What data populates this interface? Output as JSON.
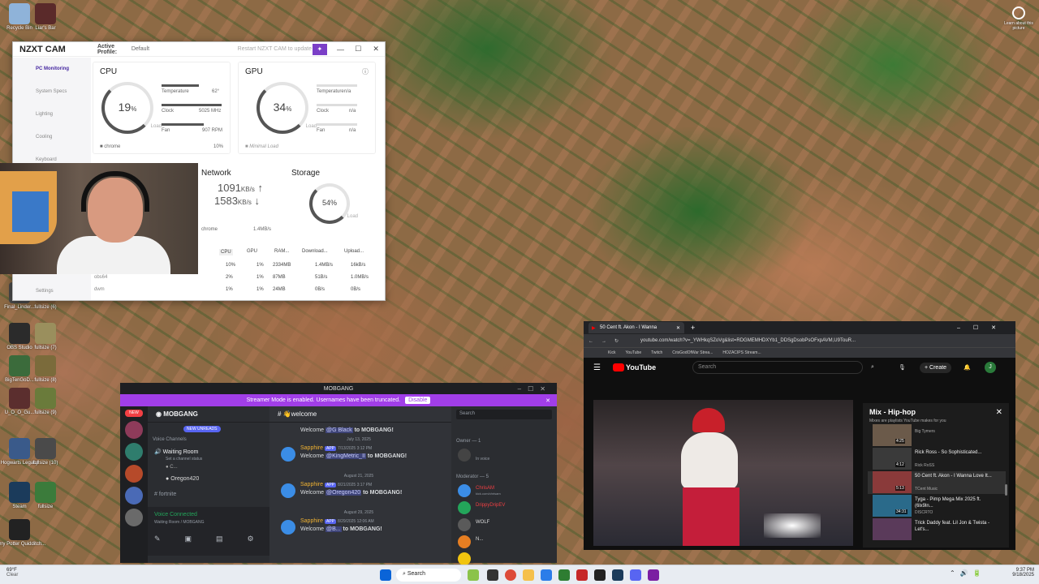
{
  "desktop": {
    "icons_left": [
      {
        "label": "Recycle Bin",
        "color": "#8fb3d9"
      },
      {
        "label": "Liar's Bar",
        "color": "#5a2a2a"
      },
      {
        "label": "OBS Studio",
        "color": "#2b2b2b"
      },
      {
        "label": "fullsize (7)",
        "color": "#9a8f5d"
      },
      {
        "label": "BigTenGoD...",
        "color": "#3b6b3b"
      },
      {
        "label": "fullsize (8)",
        "color": "#7b6b3b"
      },
      {
        "label": "U_O_O_Gu...",
        "color": "#5b2e2e"
      },
      {
        "label": "fullsize (9)",
        "color": "#6a7b3b"
      },
      {
        "label": "Hogwarts Legacy",
        "color": "#3a5a8a"
      },
      {
        "label": "fullsize (10)",
        "color": "#4a4a4a"
      },
      {
        "label": "Steam",
        "color": "#1b3b5b"
      },
      {
        "label": "fullsize",
        "color": "#3b7b3b"
      },
      {
        "label": "Harry Potter Quidditch...",
        "color": "#222222"
      },
      {
        "label": "Final_Linder...",
        "color": "#4a4a4a"
      },
      {
        "label": "fullsize (6)",
        "color": "#7b5a3b"
      }
    ],
    "learn_more": "Learn about this picture"
  },
  "nzxt": {
    "app_name": "NZXT CAM",
    "active_profile_label": "Active Profile:",
    "active_profile_value": "Default",
    "restart_label": "Restart NZXT CAM to update",
    "sidebar": [
      "PC Monitoring",
      "System Specs",
      "Lighting",
      "Cooling",
      "Keyboard"
    ],
    "settings": "Settings",
    "cpu": {
      "title": "CPU",
      "load": "19",
      "load_unit": "%",
      "load_label": "Load",
      "temp_label": "Temperature",
      "temp": "62°",
      "clock_label": "Clock",
      "clock": "5025 MHz",
      "fan_label": "Fan",
      "fan": "907 RPM",
      "top_proc": "chrome",
      "top_proc_pct": "10%"
    },
    "gpu": {
      "title": "GPU",
      "load": "34",
      "load_unit": "%",
      "load_label": "Load",
      "temp_label": "Temperature",
      "temp": "n/a",
      "clock_label": "Clock",
      "clock": "n/a",
      "fan_label": "Fan",
      "fan": "n/a",
      "note": "Minimal Load"
    },
    "network": {
      "title": "Network",
      "down": "1091",
      "down_unit": "KB/s",
      "up": "1583",
      "up_unit": "KB/s",
      "top_proc": "chrome",
      "top_proc_val": "1.4MB/s"
    },
    "storage": {
      "title": "Storage",
      "pct": "54%",
      "load_label": "Load"
    },
    "table_headers": [
      "CPU",
      "GPU",
      "RAM...",
      "Download...",
      "Upload..."
    ],
    "rows": [
      {
        "name": "chrome",
        "cpu": "10%",
        "gpu": "1%",
        "ram": "2334MB",
        "down": "1.4MB/s",
        "up": "16kB/s"
      },
      {
        "name": "obs64",
        "cpu": "2%",
        "gpu": "1%",
        "ram": "87MB",
        "down": "51B/s",
        "up": "1.0MB/s"
      },
      {
        "name": "dwm",
        "cpu": "1%",
        "gpu": "1%",
        "ram": "24MB",
        "down": "0B/s",
        "up": "0B/s"
      }
    ]
  },
  "discord": {
    "title": "MOBGANG",
    "streamer_banner": "Streamer Mode is enabled. Usernames have been truncated.",
    "disable_label": "Disable",
    "server_name": "MOBGANG",
    "new_badge": "NEW",
    "new_unreads": "NEW UNREADS",
    "voice_channels_label": "Voice Channels",
    "waiting_room": "Waiting Room",
    "channel_status": "Set a channel status",
    "voice_users": [
      "C...",
      "Oregon420"
    ],
    "fortnite": "fortnite",
    "voice_connected": "Voice Connected",
    "voice_location": "Waiting Room / MOBGANG",
    "channel": "welcome",
    "search_placeholder": "Search",
    "messages": [
      {
        "date": "",
        "name": "",
        "app": "",
        "time": "",
        "prefix": "Welcome ",
        "mention": "@G Black",
        "suffix": " to MOBGANG!"
      },
      {
        "date": "July 13, 2025",
        "name": "Sapphire",
        "app": "APP",
        "time": "7/13/2025 3:12 PM",
        "prefix": "Welcome ",
        "mention": "@KingMetric_II",
        "suffix": " to MOBGANG!"
      },
      {
        "date": "August 21, 2025",
        "name": "Sapphire",
        "app": "APP",
        "time": "8/21/2025 3:17 PM",
        "prefix": "Welcome ",
        "mention": "@Oregon420",
        "suffix": " to MOBGANG!"
      },
      {
        "date": "August 29, 2025",
        "name": "Sapphire",
        "app": "APP",
        "time": "8/29/2025 12:06 AM",
        "prefix": "Welcome ",
        "mention": "@B...",
        "suffix": " to MOBGANG!"
      }
    ],
    "owner_label": "Owner — 1",
    "owner_status": "In voice",
    "moderator_label": "Moderator — 5",
    "moderators": [
      "ChrisAM",
      "DrippyDripEV",
      "WOLF",
      "N...",
      ""
    ],
    "mod_sub": "kick.com/chrisam"
  },
  "youtube": {
    "tab_title": "50 Cent ft. Akon - I Wanna",
    "url": "youtube.com/watch?v=_YWHkqSZoVg&list=RDGMEMHDXYb1_DDSgDsobPsOFxpAVM,U9TouR...",
    "bookmarks": [
      "Kick",
      "YouTube",
      "Twitch",
      "CrisGodOfWar Strea...",
      "HOZACIPS Stream..."
    ],
    "logo": "YouTube",
    "search_placeholder": "Search",
    "create_label": "Create",
    "avatar_letter": "J",
    "mix_title": "Mix - Hip-hop",
    "mix_sub": "Mixes are playlists YouTube makes for you",
    "items": [
      {
        "title": "",
        "channel": "Big Tymers",
        "dur": "4:25",
        "color": "#6b5a4a"
      },
      {
        "title": "Rick Ross - So Sophisticated...",
        "channel": "Rick RoSS",
        "dur": "4:12",
        "color": "#3a3a3a"
      },
      {
        "title": "50 Cent ft. Akon - I Wanna Love It...",
        "channel": "TCent Music",
        "dur": "5:13",
        "color": "#8a3a3a"
      },
      {
        "title": "Tyga - Pimp Mega Mix 2025 ft. (6lx9ln...",
        "channel": "DISCRTO",
        "dur": "34:31",
        "color": "#2a6a8a"
      },
      {
        "title": "Trick Daddy feat. Lil Jon & Twista - Let's...",
        "channel": "",
        "dur": "",
        "color": "#5a3a5a"
      }
    ]
  },
  "taskbar": {
    "weather_temp": "69°F",
    "weather_desc": "Clear",
    "search": "Search",
    "time": "9:37 PM",
    "date": "9/18/2025"
  }
}
